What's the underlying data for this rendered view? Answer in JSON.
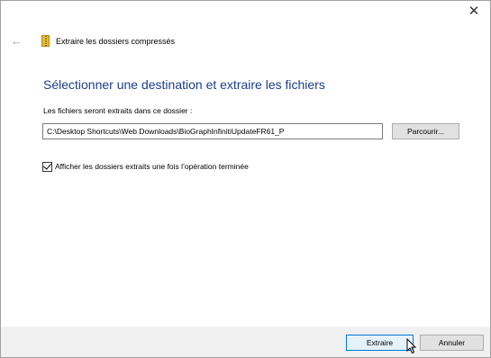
{
  "window": {
    "title": "Extraire les dossiers compressés",
    "close_glyph": "✕",
    "back_glyph": "←"
  },
  "main": {
    "heading": "Sélectionner une destination et extraire les fichiers",
    "path_label": "Les fichiers seront extraits dans ce dossier :",
    "path_value": "C:\\Desktop Shortcuts\\Web Downloads\\BioGraphInfinitiUpdateFR61_P",
    "browse_label": "Parcourir...",
    "checkbox_label": "Afficher les dossiers extraits une fois l’opération terminée",
    "checkbox_checked": true
  },
  "footer": {
    "extract_label": "Extraire",
    "cancel_label": "Annuler"
  },
  "icons": {
    "back": "back-arrow-icon",
    "zip": "zip-folder-icon",
    "close": "close-icon",
    "cursor": "mouse-pointer-icon"
  },
  "colors": {
    "heading": "#1a3e8e",
    "footer_bg": "#f0f0f0",
    "primary_border": "#0078d7"
  }
}
